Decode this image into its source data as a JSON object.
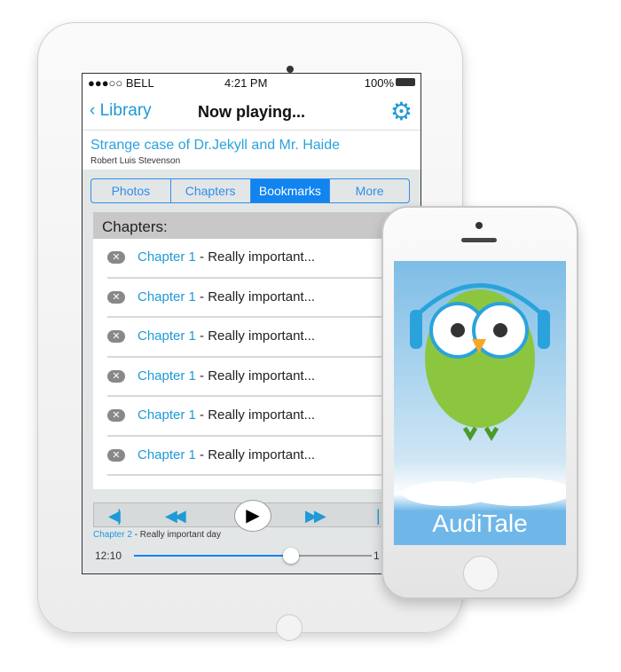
{
  "status": {
    "carrier": "●●●○○ BELL",
    "time": "4:21 PM",
    "battery": "100%"
  },
  "nav": {
    "back": "Library",
    "title": "Now playing...",
    "settings_icon": "gear-icon"
  },
  "book": {
    "title": "Strange case of Dr.Jekyll and Mr. Haide",
    "author": "Robert Luis Stevenson"
  },
  "tabs": [
    {
      "label": "Photos"
    },
    {
      "label": "Chapters"
    },
    {
      "label": "Bookmarks",
      "selected": true
    },
    {
      "label": "More"
    }
  ],
  "chapters": {
    "header": "Chapters:",
    "items": [
      {
        "chapter": "Chapter 1",
        "desc": " - Really important..."
      },
      {
        "chapter": "Chapter 1",
        "desc": " - Really important..."
      },
      {
        "chapter": "Chapter 1",
        "desc": " - Really important..."
      },
      {
        "chapter": "Chapter 1",
        "desc": " - Really important..."
      },
      {
        "chapter": "Chapter 1",
        "desc": " - Really important..."
      },
      {
        "chapter": "Chapter 1",
        "desc": " - Really important..."
      }
    ]
  },
  "player": {
    "now_chapter": "Chapter 2",
    "now_desc": " - Really important day",
    "elapsed": "12:10",
    "end": "1",
    "progress": 0.66
  },
  "phone": {
    "app_name": "AudiTale"
  },
  "colors": {
    "accent": "#1e9ad6",
    "selected_tab": "#1184f0"
  }
}
